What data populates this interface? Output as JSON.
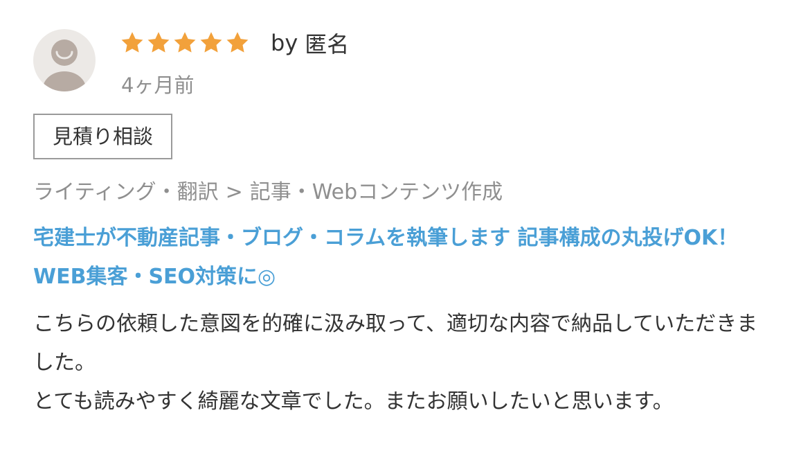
{
  "review": {
    "rating": 5,
    "rating_max": 5,
    "by_label": "by",
    "reviewer": "匿名",
    "date": "4ヶ月前",
    "tag": "見積り相談",
    "category": {
      "parent": "ライティング・翻訳",
      "separator": ">",
      "child": "記事・Webコンテンツ作成"
    },
    "service_title": "宅建士が不動産記事・ブログ・コラムを執筆します 記事構成の丸投げOK！WEB集客・SEO対策に◎",
    "body": [
      "こちらの依頼した意図を的確に汲み取って、適切な内容で納品していただきました。",
      "とても読みやすく綺麗な文章でした。またお願いしたいと思います。"
    ]
  },
  "colors": {
    "star": "#f2a13b",
    "link": "#4a9fd6",
    "muted": "#8f8f8f",
    "text": "#333333",
    "avatar_bg": "#ece9e6",
    "avatar_fg": "#b7aba3"
  },
  "icons": {
    "avatar": "default-user-avatar-icon",
    "star": "star-icon"
  }
}
